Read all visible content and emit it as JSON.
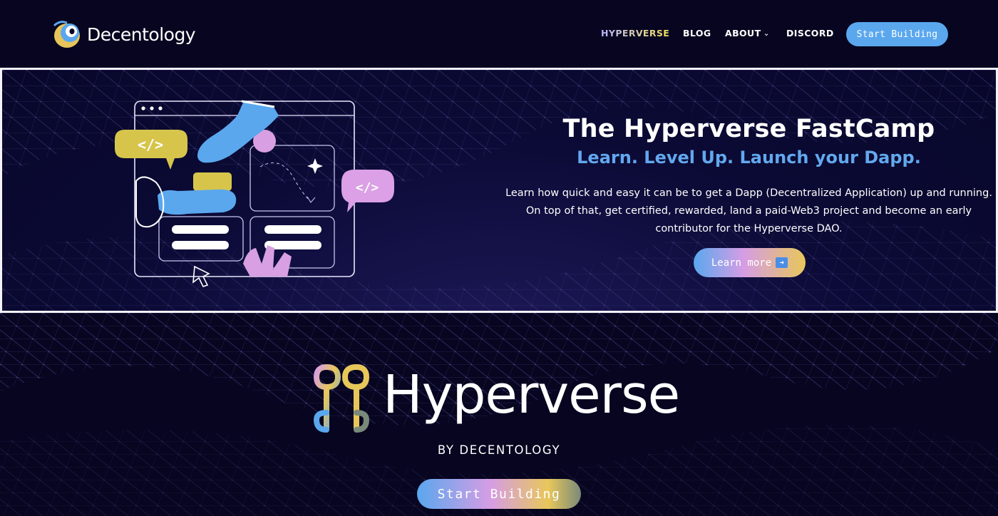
{
  "brand": {
    "name": "Decentology"
  },
  "nav": {
    "items": [
      {
        "label": "HYPERVERSE",
        "active": true
      },
      {
        "label": "BLOG"
      },
      {
        "label": "ABOUT",
        "has_dropdown": true
      },
      {
        "label": "DISCORD"
      }
    ],
    "cta": "Start Building"
  },
  "banner": {
    "title": "The Hyperverse FastCamp",
    "subtitle": "Learn. Level Up. Launch your Dapp.",
    "description": "Learn how quick and easy it can be to get a Dapp (Decentralized Application) up and running. On top of that, get certified, rewarded, land a paid-Web3 project and become an early contributor for the Hyperverse DAO.",
    "cta": "Learn more",
    "cta_icon": "arrow-right-icon"
  },
  "hero": {
    "wordmark": "Hyperverse",
    "byline": "BY DECENTOLOGY",
    "cta": "Start Building"
  },
  "colors": {
    "background": "#070520",
    "accent_blue": "#5aa7ee",
    "accent_pink": "#d69de4",
    "accent_yellow": "#e8c75a",
    "subtitle_blue": "#62a8ee"
  }
}
